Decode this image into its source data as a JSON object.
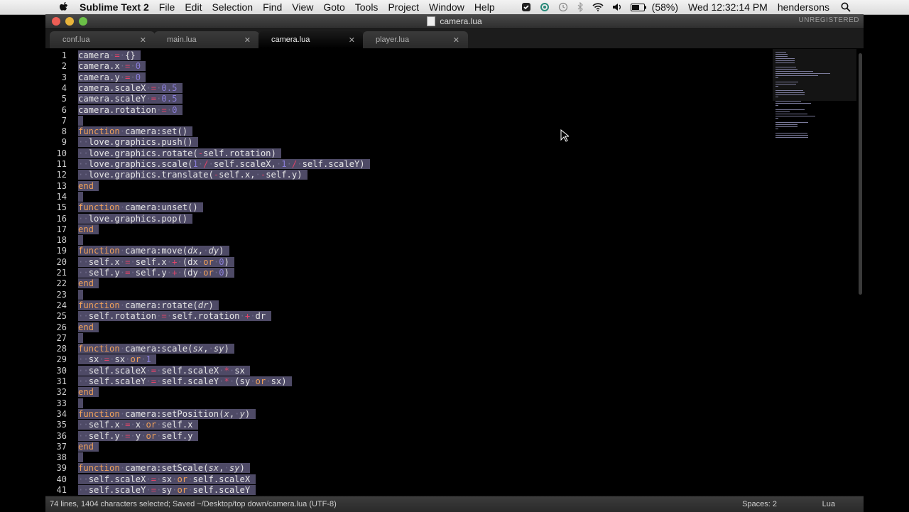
{
  "menubar": {
    "app_name": "Sublime Text 2",
    "menus": [
      "File",
      "Edit",
      "Selection",
      "Find",
      "View",
      "Goto",
      "Tools",
      "Project",
      "Window",
      "Help"
    ],
    "battery": "(58%)",
    "clock": "Wed 12:32:14 PM",
    "user": "hendersons"
  },
  "window": {
    "title": "camera.lua",
    "license": "UNREGISTERED"
  },
  "tabs": [
    {
      "label": "conf.lua",
      "active": false
    },
    {
      "label": "main.lua",
      "active": false
    },
    {
      "label": "camera.lua",
      "active": true
    },
    {
      "label": "player.lua",
      "active": false
    }
  ],
  "editor": {
    "language": "Lua",
    "lines": [
      "camera = {}",
      "camera.x = 0",
      "camera.y = 0",
      "camera.scaleX = 0.5",
      "camera.scaleY = 0.5",
      "camera.rotation = 0",
      "",
      "function camera:set()",
      "  love.graphics.push()",
      "  love.graphics.rotate(-self.rotation)",
      "  love.graphics.scale(1 / self.scaleX, 1 / self.scaleY)",
      "  love.graphics.translate(-self.x, -self.y)",
      "end",
      "",
      "function camera:unset()",
      "  love.graphics.pop()",
      "end",
      "",
      "function camera:move(dx, dy)",
      "  self.x = self.x + (dx or 0)",
      "  self.y = self.y + (dy or 0)",
      "end",
      "",
      "function camera:rotate(dr)",
      "  self.rotation = self.rotation + dr",
      "end",
      "",
      "function camera:scale(sx, sy)",
      "  sx = sx or 1",
      "  self.scaleX = self.scaleX * sx",
      "  self.scaleY = self.scaleY * (sy or sx)",
      "end",
      "",
      "function camera:setPosition(x, y)",
      "  self.x = x or self.x",
      "  self.y = y or self.y",
      "end",
      "",
      "function camera:setScale(sx, sy)",
      "  self.scaleX = sx or self.scaleX",
      "  self.scaleY = sy or self.scaleY"
    ]
  },
  "statusbar": {
    "message": "74 lines, 1404 characters selected; Saved ~/Desktop/top down/camera.lua (UTF-8)",
    "spaces": "Spaces: 2",
    "syntax": "Lua"
  }
}
